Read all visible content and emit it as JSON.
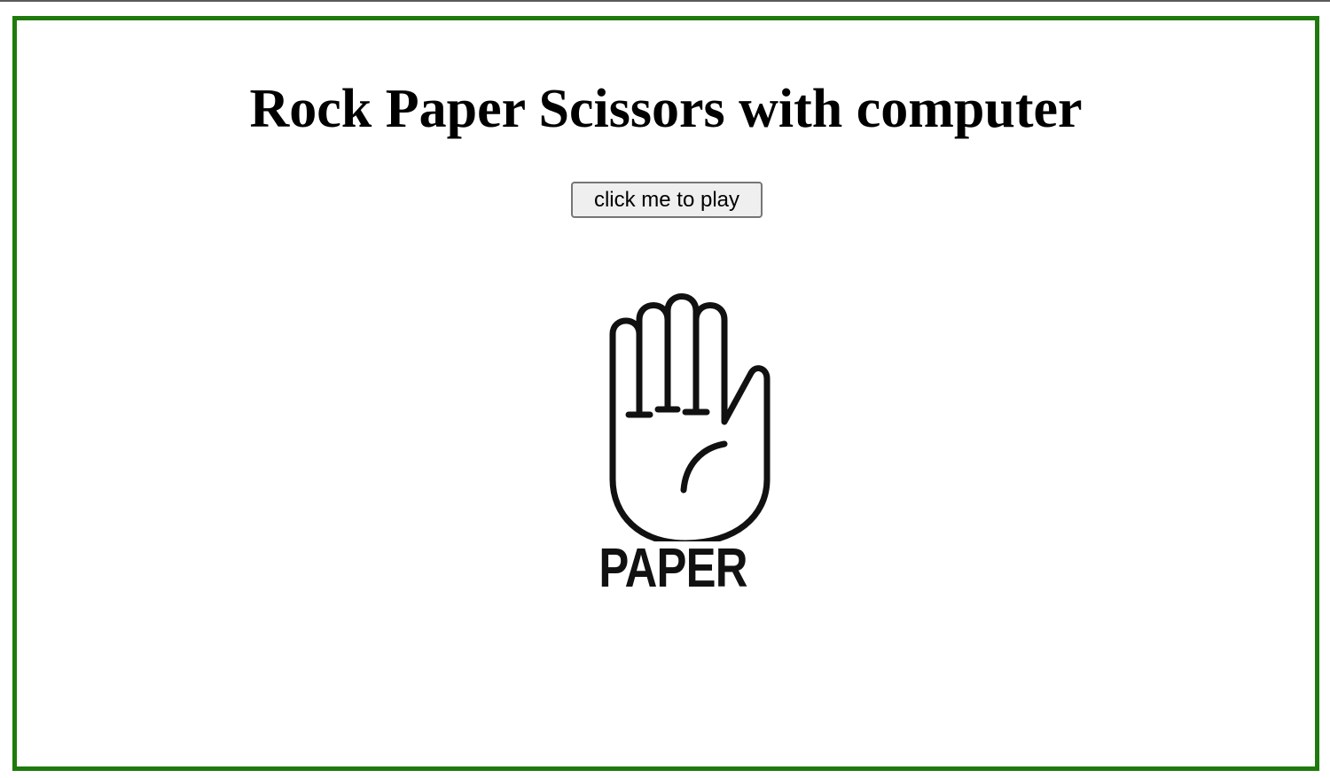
{
  "game": {
    "title": "Rock Paper Scissors with computer",
    "play_button_label": "click me to play",
    "current_choice": {
      "icon": "open-hand-paper-icon",
      "label": "PAPER"
    }
  },
  "colors": {
    "frame_border": "#1f7a0c",
    "icon_stroke": "#111111"
  }
}
